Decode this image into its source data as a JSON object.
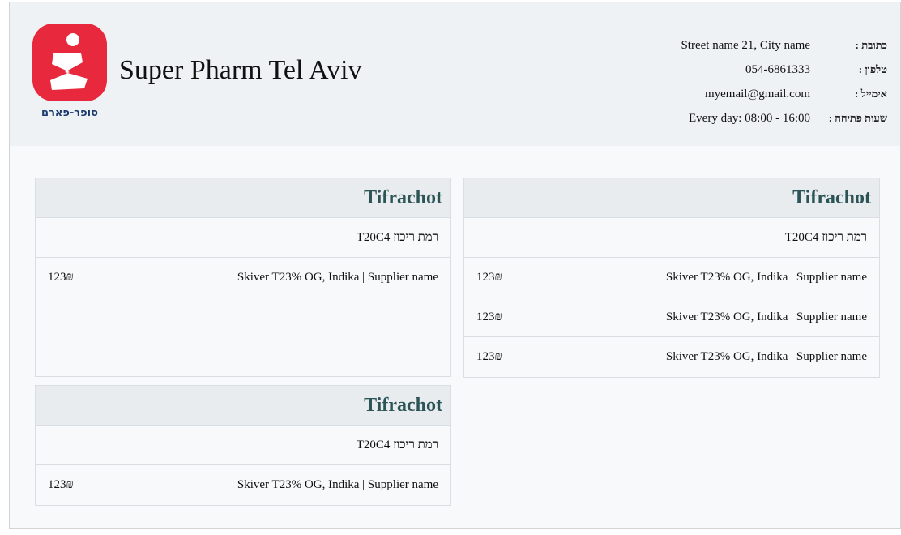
{
  "store": {
    "name": "Super Pharm Tel Aviv",
    "logo_text": "סופר-פארם",
    "logo_glyph": "s"
  },
  "contact": {
    "address_label": "כתובת :",
    "address": "Street name 21, City name",
    "phone_label": "טלפון :",
    "phone": "054-6861333",
    "email_label": "אימייל :",
    "email": "myemail@gmail.com",
    "hours_label": "שעות פתיחה :",
    "hours": "Every day: 08:00 - 16:00"
  },
  "colors": {
    "brand_red": "#e8283c",
    "card_title": "#2c5456"
  },
  "cards": [
    {
      "title": "Tifrachot",
      "subtitle": "רמת ריכוז T20C4",
      "items": [
        {
          "name": "Skiver T23% OG, Indika | Supplier name",
          "price": "123₪"
        },
        {
          "name": "Skiver T23% OG, Indika | Supplier name",
          "price": "123₪"
        },
        {
          "name": "Skiver T23% OG, Indika | Supplier name",
          "price": "123₪"
        }
      ]
    },
    {
      "title": "Tifrachot",
      "subtitle": "רמת ריכוז T20C4",
      "items": [
        {
          "name": "Skiver T23% OG, Indika | Supplier name",
          "price": "123₪"
        }
      ]
    },
    {
      "title": "Tifrachot",
      "subtitle": "רמת ריכוז T20C4",
      "items": [
        {
          "name": "Skiver T23% OG, Indika | Supplier name",
          "price": "123₪"
        }
      ]
    }
  ]
}
